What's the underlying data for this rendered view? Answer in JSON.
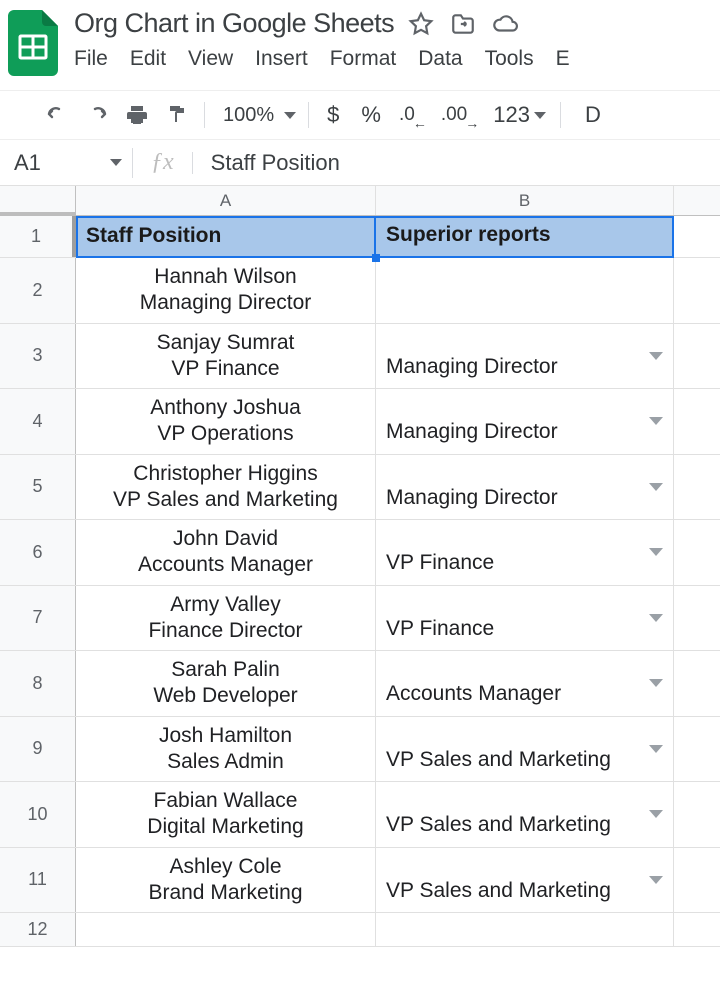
{
  "doc": {
    "title": "Org Chart in Google Sheets"
  },
  "menus": {
    "file": "File",
    "edit": "Edit",
    "view": "View",
    "insert": "Insert",
    "format": "Format",
    "data": "Data",
    "tools": "Tools",
    "extensions_initial": "E"
  },
  "toolbar": {
    "zoom": "100%",
    "currency": "$",
    "percent": "%",
    "dec_decrease": ".0",
    "dec_increase": ".00",
    "fmt123": "123",
    "right_initial": "D"
  },
  "namebox": {
    "ref": "A1"
  },
  "formula": {
    "value": "Staff Position"
  },
  "headers": {
    "A": "A",
    "B": "B"
  },
  "sheet": {
    "head_a": "Staff Position",
    "head_b": "Superior reports",
    "rows": [
      {
        "n": "2",
        "a1": "Hannah Wilson",
        "a2": "Managing Director",
        "b": "",
        "dd": false
      },
      {
        "n": "3",
        "a1": "Sanjay Sumrat",
        "a2": "VP Finance",
        "b": "Managing Director",
        "dd": true
      },
      {
        "n": "4",
        "a1": "Anthony Joshua",
        "a2": "VP Operations",
        "b": "Managing Director",
        "dd": true
      },
      {
        "n": "5",
        "a1": "Christopher Higgins",
        "a2": "VP Sales and Marketing",
        "b": "Managing Director",
        "dd": true
      },
      {
        "n": "6",
        "a1": "John David",
        "a2": "Accounts Manager",
        "b": "VP Finance",
        "dd": true
      },
      {
        "n": "7",
        "a1": "Army Valley",
        "a2": "Finance Director",
        "b": "VP Finance",
        "dd": true
      },
      {
        "n": "8",
        "a1": "Sarah Palin",
        "a2": "Web Developer",
        "b": "Accounts Manager",
        "dd": true
      },
      {
        "n": "9",
        "a1": "Josh Hamilton",
        "a2": "Sales Admin",
        "b": "VP Sales and Marketing",
        "dd": true
      },
      {
        "n": "10",
        "a1": "Fabian Wallace",
        "a2": "Digital Marketing",
        "b": "VP Sales and Marketing",
        "dd": true
      },
      {
        "n": "11",
        "a1": "Ashley Cole",
        "a2": "Brand Marketing",
        "b": "VP Sales and Marketing",
        "dd": true
      }
    ],
    "empty_row": "12"
  }
}
